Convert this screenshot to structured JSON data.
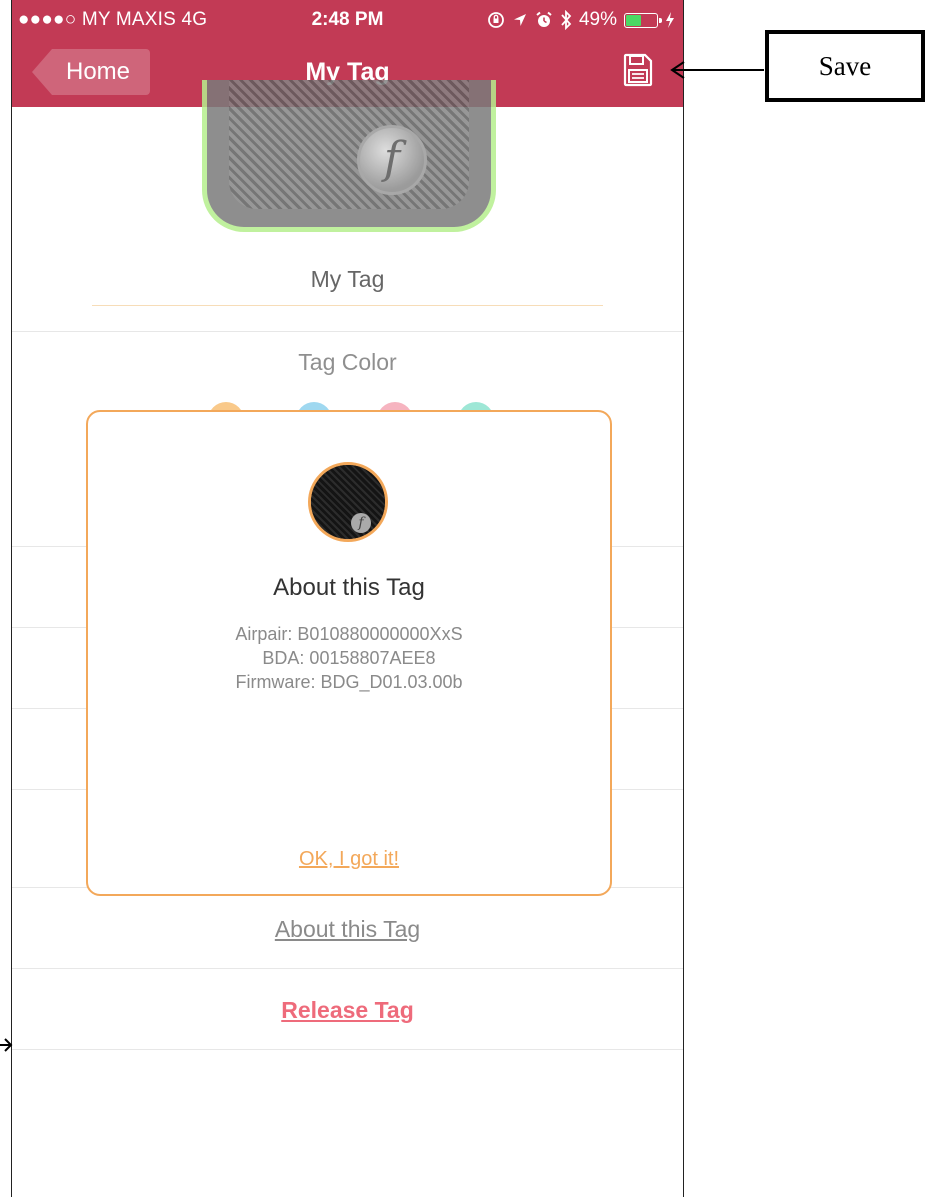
{
  "status_bar": {
    "carrier": "●●●●○ MY MAXIS  4G",
    "time": "2:48 PM",
    "battery": "49%",
    "battery_level": 0.49
  },
  "nav": {
    "back_label": "Home",
    "title": "My Tag",
    "save_icon": "floppy-disk-icon"
  },
  "tag": {
    "name": "My Tag",
    "color_label": "Tag Color",
    "swatches": [
      "#f9c98a",
      "#9fd8f0",
      "#f6b4c0",
      "#9ee7d6"
    ]
  },
  "links": {
    "about": "About this Tag",
    "release": "Release Tag"
  },
  "modal": {
    "title": "About this Tag",
    "airpair": "Airpair: B010880000000XxS",
    "bda": "BDA: 00158807AEE8",
    "firmware": "Firmware: BDG_D01.03.00b",
    "ok_label": "OK, I got it!"
  },
  "callout": {
    "label": "Save"
  },
  "colors": {
    "brand": "#c23a55",
    "accent": "#f3a85a",
    "danger": "#ee6b7b"
  }
}
